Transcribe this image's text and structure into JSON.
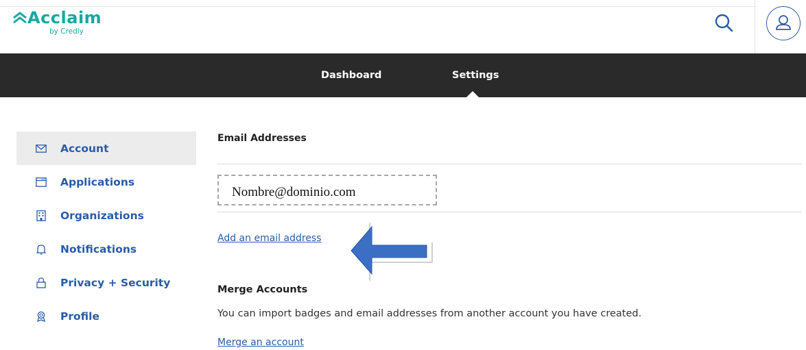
{
  "brand": {
    "name": "Acclaim",
    "sub": "by Credly",
    "color": "#16a9a0"
  },
  "header": {
    "search_icon": "search-icon",
    "avatar_icon": "user-icon"
  },
  "nav": {
    "tabs": [
      {
        "label": "Dashboard"
      },
      {
        "label": "Settings",
        "active": true
      }
    ]
  },
  "sidebar": {
    "items": [
      {
        "label": "Account",
        "icon": "envelope-icon",
        "active": true
      },
      {
        "label": "Applications",
        "icon": "window-icon"
      },
      {
        "label": "Organizations",
        "icon": "building-icon"
      },
      {
        "label": "Notifications",
        "icon": "bell-icon"
      },
      {
        "label": "Privacy + Security",
        "icon": "lock-icon"
      },
      {
        "label": "Profile",
        "icon": "badge-icon"
      }
    ]
  },
  "email_section": {
    "title": "Email Addresses",
    "email": "Nombre@dominio.com",
    "add_link": "Add an email address"
  },
  "merge_section": {
    "title": "Merge Accounts",
    "description": "You can import badges and email addresses from another account you have created.",
    "merge_link": "Merge an account"
  },
  "colors": {
    "link": "#2a5ba8",
    "nav_bg": "#2a2a2a",
    "arrow": "#3b6fc4"
  }
}
